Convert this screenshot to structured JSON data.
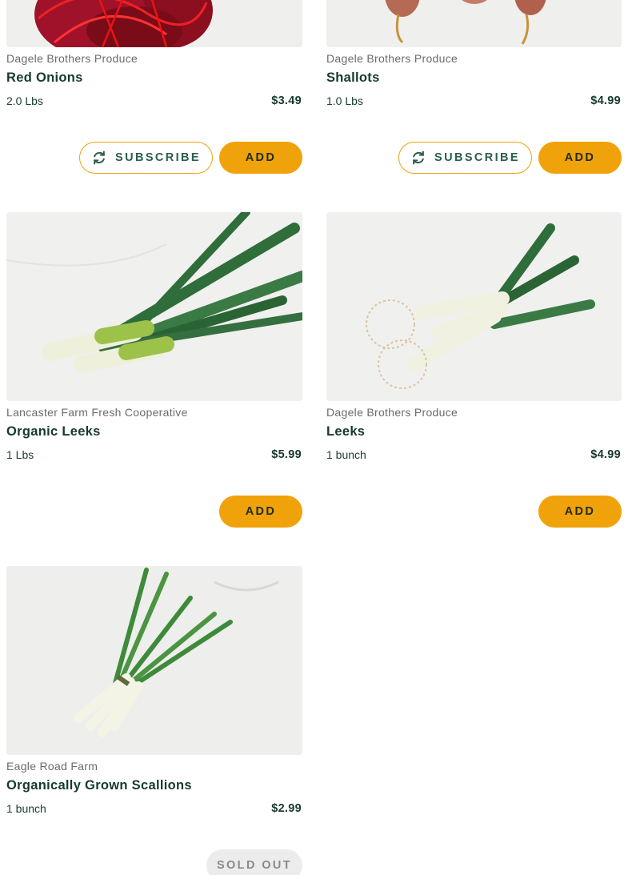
{
  "products": [
    {
      "vendor": "Dagele Brothers Produce",
      "name": "Red Onions",
      "size": "2.0 Lbs",
      "price": "$3.49",
      "subscribe_label": "SUBSCRIBE",
      "add_label": "ADD"
    },
    {
      "vendor": "Dagele Brothers Produce",
      "name": "Shallots",
      "size": "1.0 Lbs",
      "price": "$4.99",
      "subscribe_label": "SUBSCRIBE",
      "add_label": "ADD"
    },
    {
      "vendor": "Lancaster Farm Fresh Cooperative",
      "name": "Organic Leeks",
      "size": "1 Lbs",
      "price": "$5.99",
      "add_label": "ADD"
    },
    {
      "vendor": "Dagele Brothers Produce",
      "name": "Leeks",
      "size": "1 bunch",
      "price": "$4.99",
      "add_label": "ADD"
    },
    {
      "vendor": "Eagle Road Farm",
      "name": "Organically Grown Scallions",
      "size": "1 bunch",
      "price": "$2.99",
      "sold_out_label": "SOLD OUT"
    }
  ],
  "colors": {
    "accent": "#f0a20a",
    "text_dark": "#173a2e",
    "subscribe_text": "#2b5e4c",
    "muted": "#6b6b6b"
  },
  "icons": {
    "subscribe": "refresh-icon"
  }
}
